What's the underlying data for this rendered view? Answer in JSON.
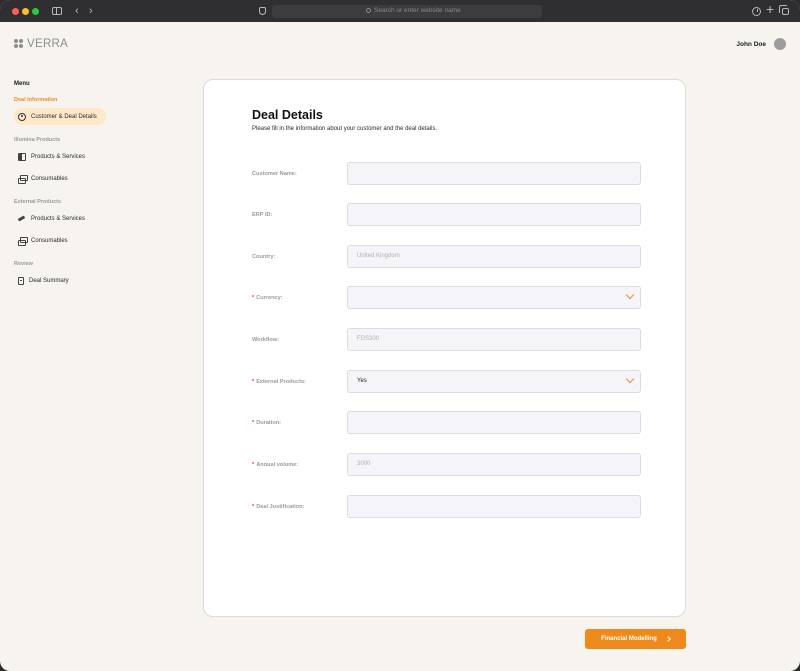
{
  "browser": {
    "url_placeholder": "Search or enter website name"
  },
  "header": {
    "logo_text": "VERRA",
    "user_name": "John Doe"
  },
  "sidebar": {
    "menu_title": "Menu",
    "sections": [
      {
        "label": "Deal Information",
        "items": [
          {
            "label": "Customer & Deal Details",
            "icon": "user-circle-icon"
          }
        ]
      },
      {
        "label": "Illumina Products",
        "items": [
          {
            "label": "Products & Services",
            "icon": "box-icon"
          },
          {
            "label": "Consumables",
            "icon": "stack-icon"
          }
        ]
      },
      {
        "label": "External Products",
        "items": [
          {
            "label": "Products & Services",
            "icon": "pen-icon"
          },
          {
            "label": "Consumables",
            "icon": "stack-icon"
          }
        ]
      },
      {
        "label": "Review",
        "items": [
          {
            "label": "Deal Summary",
            "icon": "document-icon"
          }
        ]
      }
    ]
  },
  "form": {
    "title": "Deal Details",
    "subtitle": "Please fill in the information about your customer and the deal details.",
    "fields": [
      {
        "label": "Customer Name:",
        "required": false,
        "value": "",
        "placeholder": ""
      },
      {
        "label": "ERP ID:",
        "required": false,
        "value": "",
        "placeholder": ""
      },
      {
        "label": "Country:",
        "required": false,
        "value": "",
        "placeholder": "United Kingdom"
      },
      {
        "label": "Currency:",
        "required": true,
        "value": "",
        "placeholder": "",
        "dropdown": true
      },
      {
        "label": "Workflow:",
        "required": false,
        "value": "",
        "placeholder": "FDS300"
      },
      {
        "label": "External Products:",
        "required": true,
        "value": "Yes",
        "placeholder": "",
        "dropdown": true
      },
      {
        "label": "Duration:",
        "required": true,
        "value": "",
        "placeholder": ""
      },
      {
        "label": "Annual volume:",
        "required": true,
        "value": "",
        "placeholder": "3000"
      },
      {
        "label": "Deal Justification:",
        "required": true,
        "value": "",
        "placeholder": ""
      }
    ],
    "required_marker": "*"
  },
  "footer": {
    "next_button_label": "Financial Modelling"
  },
  "colors": {
    "accent": "#ee8a1b",
    "required": "#e0411f",
    "background": "#f7f4ef"
  }
}
